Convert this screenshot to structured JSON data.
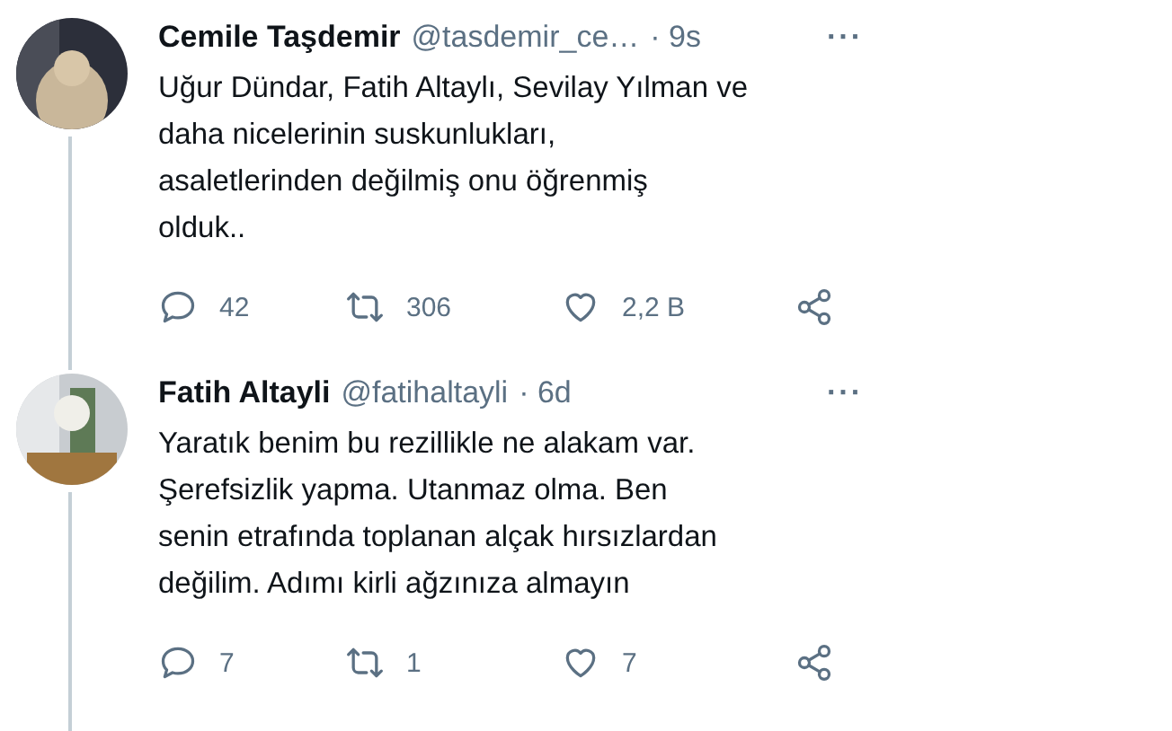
{
  "tweets": [
    {
      "name": "Cemile Taşdemir",
      "handle": "@tasdemir_ce…",
      "time": "· 9s",
      "more": "···",
      "text_lines": [
        "Uğur Dündar, Fatih Altaylı, Sevilay Yılman ve",
        "daha nicelerinin suskunlukları,",
        "asaletlerinden değilmiş onu öğrenmiş",
        "olduk.."
      ],
      "replies": "42",
      "retweets": "306",
      "likes": "2,2 B"
    },
    {
      "name": "Fatih Altayli",
      "handle": "@fatihaltayli",
      "time": "· 6d",
      "more": "···",
      "text_lines": [
        "Yaratık benim bu rezillikle ne alakam var.",
        "Şerefsizlik yapma. Utanmaz olma. Ben",
        "senin etrafında toplanan alçak hırsızlardan",
        "değilim. Adımı kirli ağzınıza almayın"
      ],
      "replies": "7",
      "retweets": "1",
      "likes": "7"
    }
  ]
}
